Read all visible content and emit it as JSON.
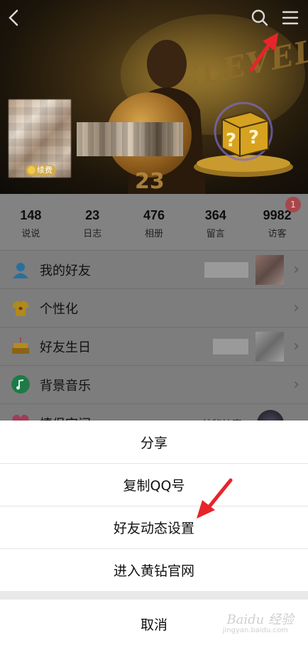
{
  "header": {
    "vip_badge": "续费",
    "cover_text": "CLEVELAND",
    "jersey_number": "23"
  },
  "stats": [
    {
      "value": "148",
      "label": "说说"
    },
    {
      "value": "23",
      "label": "日志"
    },
    {
      "value": "476",
      "label": "相册"
    },
    {
      "value": "364",
      "label": "留言"
    },
    {
      "value": "9982",
      "label": "访客",
      "badge": "1"
    }
  ],
  "menu_rows": [
    {
      "label": "我的好友",
      "icon": "friends-icon"
    },
    {
      "label": "个性化",
      "icon": "tshirt-icon"
    },
    {
      "label": "好友生日",
      "icon": "cake-icon"
    },
    {
      "label": "背景音乐",
      "icon": "music-icon"
    },
    {
      "label": "情侣空间",
      "icon": "heart-icon",
      "right_text": "神秘访客"
    }
  ],
  "action_sheet": {
    "items": [
      "分享",
      "复制QQ号",
      "好友动态设置",
      "进入黄钻官网"
    ],
    "cancel": "取消"
  },
  "watermark": {
    "text": "Baidu 经验",
    "sub": "jingyan.baidu.com"
  },
  "colors": {
    "arrow": "#e8242b",
    "notif_badge": "#e5474f"
  }
}
